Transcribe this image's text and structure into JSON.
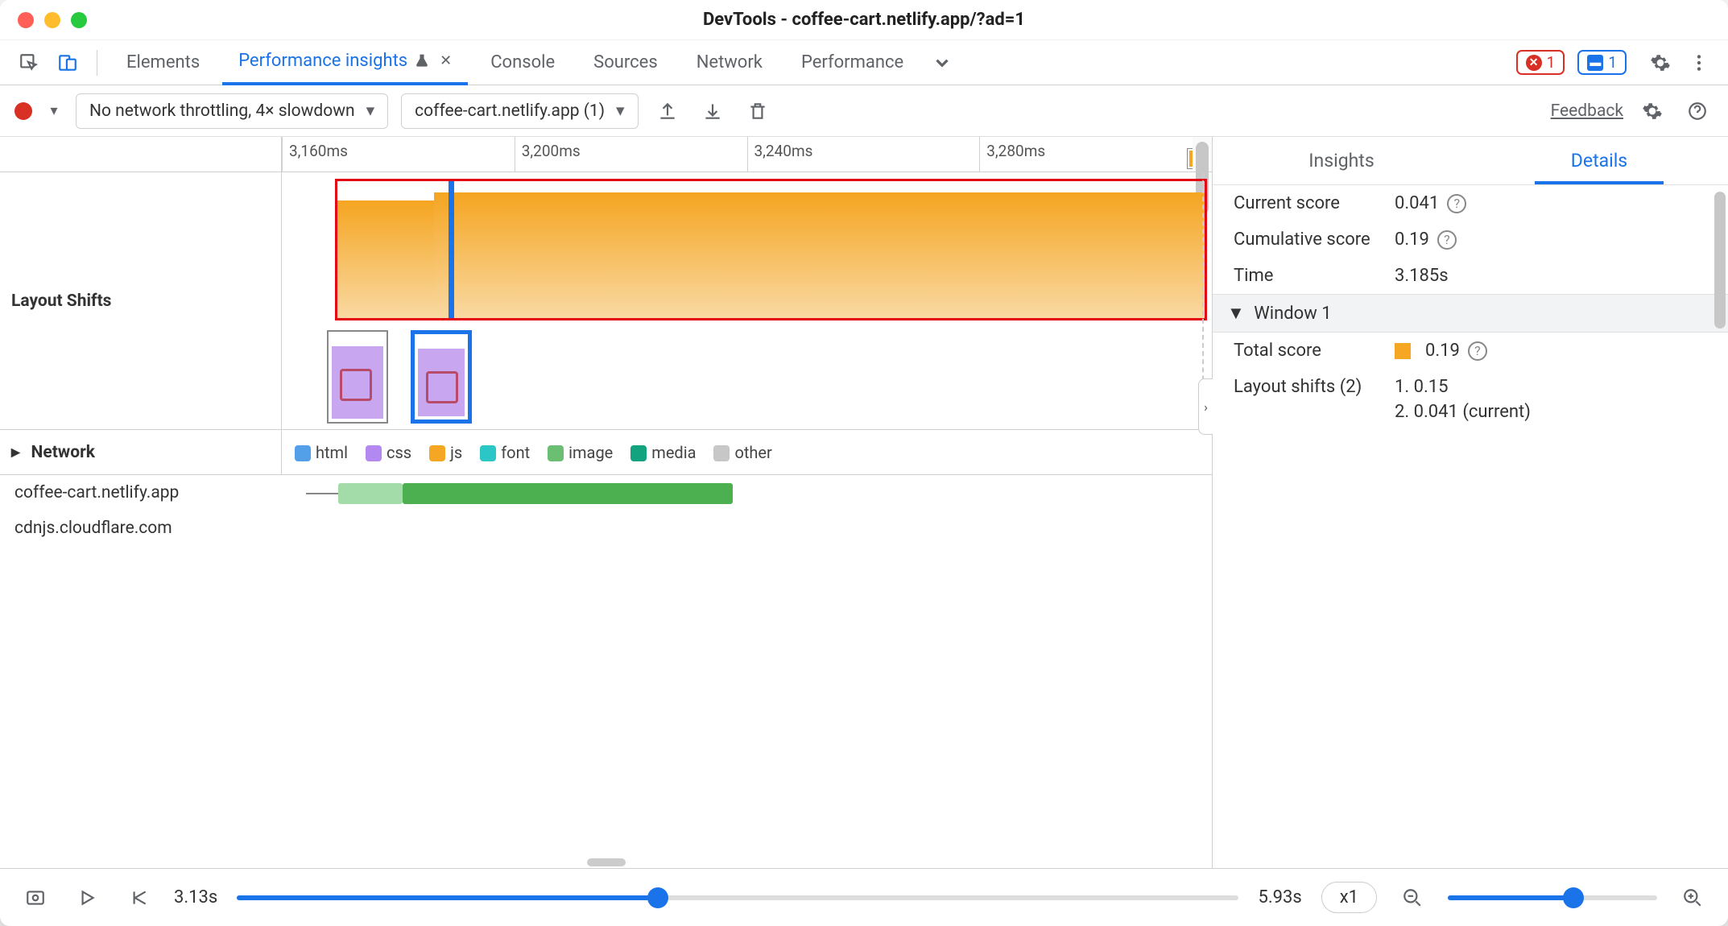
{
  "window": {
    "title": "DevTools - coffee-cart.netlify.app/?ad=1"
  },
  "tabs": {
    "elements": "Elements",
    "perf_insights": "Performance insights",
    "console": "Console",
    "sources": "Sources",
    "network": "Network",
    "performance": "Performance"
  },
  "badges": {
    "errors": "1",
    "issues": "1"
  },
  "toolbar": {
    "throttling": "No network throttling, 4× slowdown",
    "recording": "coffee-cart.netlify.app (1)",
    "feedback": "Feedback"
  },
  "timeline": {
    "ticks": [
      "3,160ms",
      "3,200ms",
      "3,240ms",
      "3,280ms"
    ]
  },
  "lanes": {
    "layout_shifts": "Layout Shifts",
    "network": "Network"
  },
  "legend": {
    "html": "html",
    "css": "css",
    "js": "js",
    "font": "font",
    "image": "image",
    "media": "media",
    "other": "other"
  },
  "colors": {
    "html": "#54a0e8",
    "css": "#b388f0",
    "js": "#f5a623",
    "font": "#2dc6c6",
    "image": "#6bbf72",
    "media": "#14a37f",
    "other": "#c7c7c7"
  },
  "net_hosts": [
    "coffee-cart.netlify.app",
    "cdnjs.cloudflare.com"
  ],
  "sidebar": {
    "tabs": {
      "insights": "Insights",
      "details": "Details"
    },
    "current_score_label": "Current score",
    "current_score": "0.041",
    "cumulative_score_label": "Cumulative score",
    "cumulative_score": "0.19",
    "time_label": "Time",
    "time": "3.185s",
    "window_head": "Window 1",
    "total_score_label": "Total score",
    "total_score": "0.19",
    "shifts_label": "Layout shifts (2)",
    "shift1": "1. 0.15",
    "shift2": "2. 0.041 (current)"
  },
  "playback": {
    "start": "3.13s",
    "end": "5.93s",
    "speed": "x1"
  }
}
